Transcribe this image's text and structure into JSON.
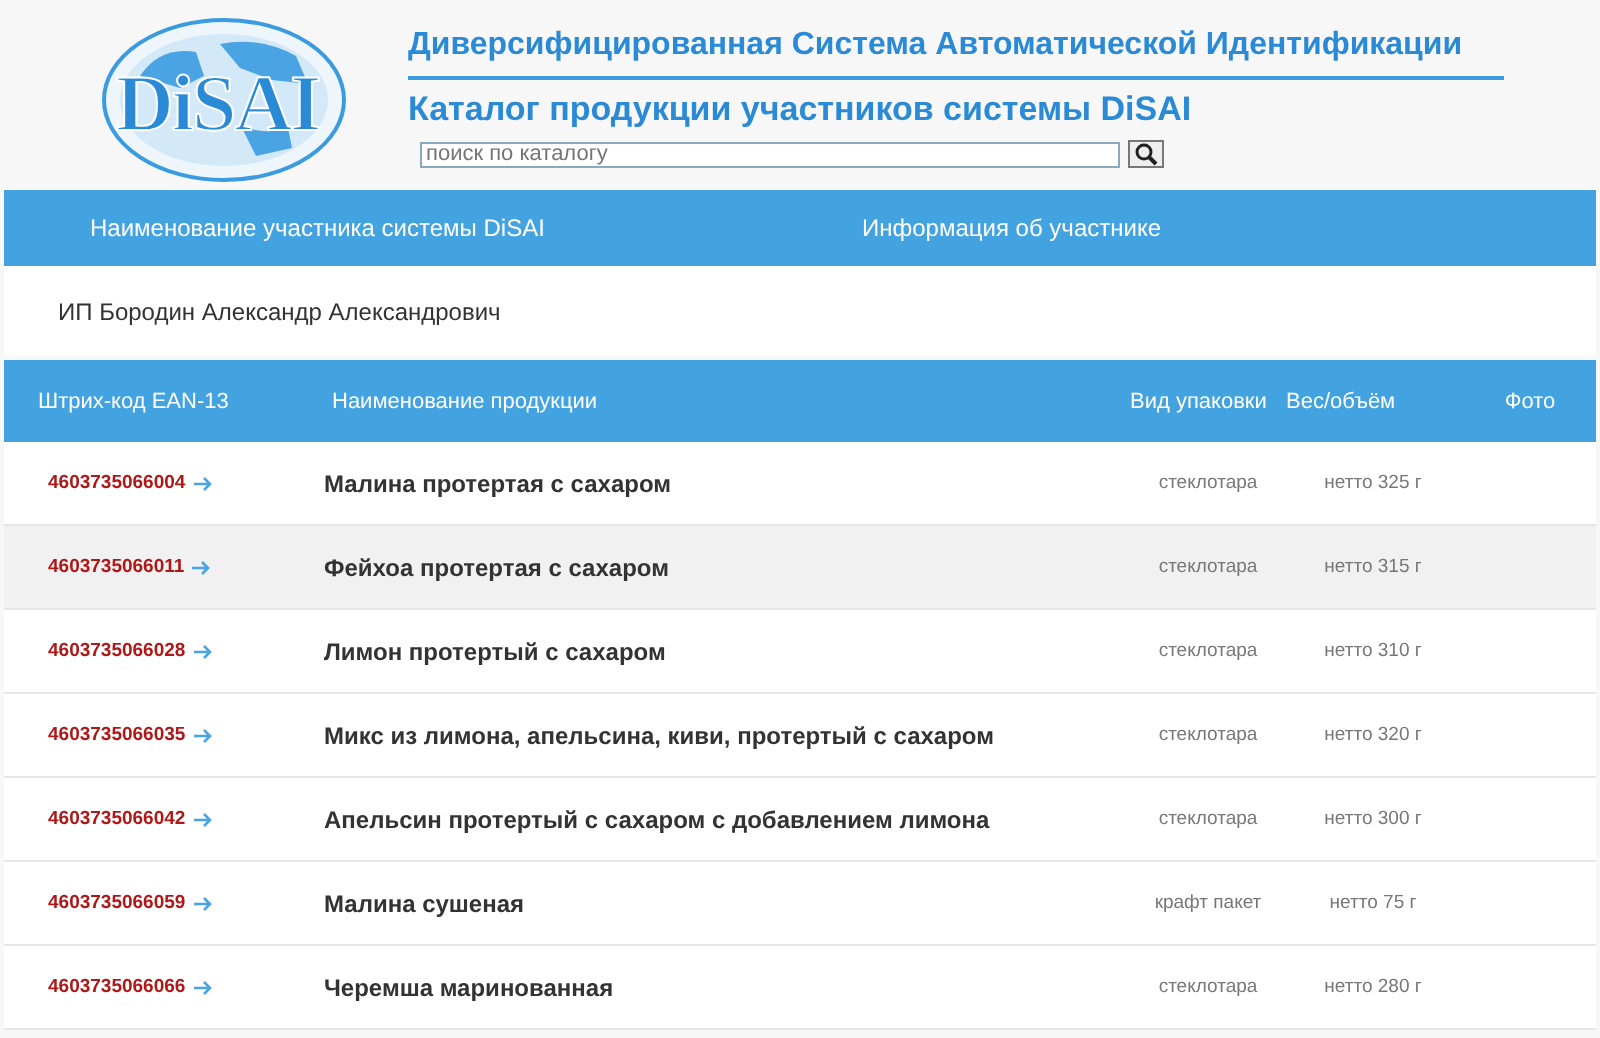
{
  "header": {
    "logo": "DiSAI",
    "title": "Диверсифицированная Система Автоматической Идентификации",
    "subtitle": "Каталог продукции участников системы DiSAI",
    "search": {
      "placeholder": "поиск по каталогу"
    }
  },
  "participant": {
    "columns": [
      "Наименование участника системы DiSAI",
      "Информация об участнике"
    ],
    "name": "ИП Бородин Александр Александрович"
  },
  "table": {
    "columns": [
      "Штрих-код EAN-13",
      "Наименование продукции",
      "Вид упаковки",
      "Вес/объём",
      "Фото"
    ],
    "rows": [
      {
        "barcode": "4603735066004",
        "name": "Малина протертая с сахаром",
        "package": "стеклотара",
        "weight": "нетто 325 г",
        "selected": false
      },
      {
        "barcode": "4603735066011",
        "name": "Фейхоа протертая с сахаром",
        "package": "стеклотара",
        "weight": "нетто 315 г",
        "selected": true
      },
      {
        "barcode": "4603735066028",
        "name": "Лимон протертый с сахаром",
        "package": "стеклотара",
        "weight": "нетто 310 г",
        "selected": false
      },
      {
        "barcode": "4603735066035",
        "name": "Микс из лимона, апельсина, киви, протертый с сахаром",
        "package": "стеклотара",
        "weight": "нетто 320 г",
        "selected": false
      },
      {
        "barcode": "4603735066042",
        "name": "Апельсин протертый с сахаром с добавлением лимона",
        "package": "стеклотара",
        "weight": "нетто 300 г",
        "selected": false
      },
      {
        "barcode": "4603735066059",
        "name": "Малина сушеная",
        "package": "крафт пакет",
        "weight": "нетто 75 г",
        "selected": false
      },
      {
        "barcode": "4603735066066",
        "name": "Черемша маринованная",
        "package": "стеклотара",
        "weight": "нетто 280 г",
        "selected": false
      }
    ]
  }
}
